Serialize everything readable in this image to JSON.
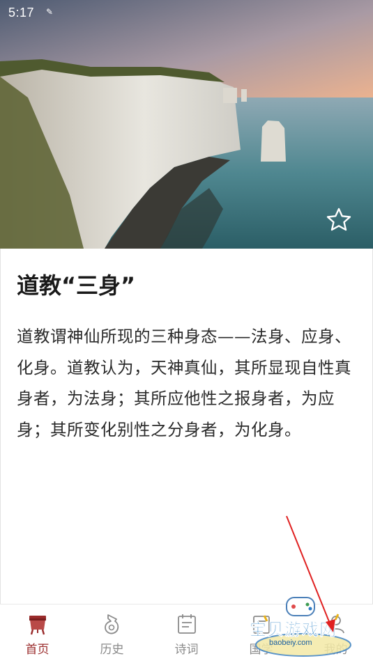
{
  "status": {
    "time": "5:17",
    "glyph": "✎"
  },
  "article": {
    "title": "道教“三身”",
    "body": "道教谓神仙所现的三种身态——法身、应身、化身。道教认为，天神真仙，其所显现自性真身者，为法身；其所应他性之报身者，为应身；其所变化别性之分身者，为化身。",
    "favorite_icon": "star-outline-icon"
  },
  "tabs": [
    {
      "label": "首页",
      "icon": "home-cauldron-icon",
      "active": true
    },
    {
      "label": "历史",
      "icon": "history-vase-icon",
      "active": false
    },
    {
      "label": "诗词",
      "icon": "poetry-book-icon",
      "active": false
    },
    {
      "label": "国学",
      "icon": "classics-icon",
      "active": false
    },
    {
      "label": "我的",
      "icon": "profile-icon",
      "active": false
    }
  ],
  "watermark": {
    "text": "宝贝游戏网",
    "sub": "baobeiy.com"
  },
  "colors": {
    "accent": "#9a2b2b",
    "inactive": "#8a8a8a",
    "arrow": "#e02020"
  }
}
